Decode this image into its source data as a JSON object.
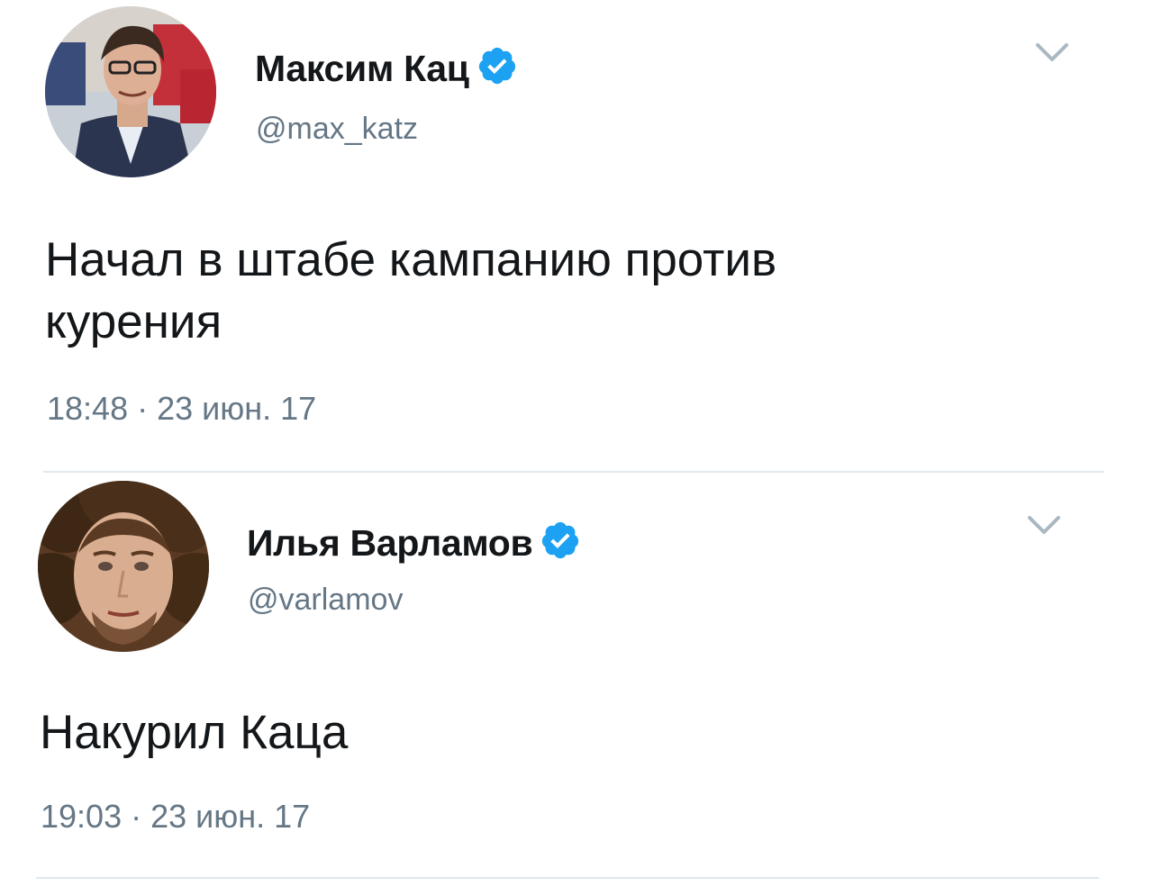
{
  "tweets": [
    {
      "display_name": "Максим Кац",
      "handle": "@max_katz",
      "verified": true,
      "text_lines": [
        "Начал в штабе кампанию против",
        "курения"
      ],
      "timestamp": "18:48 · 23 июн. 17",
      "avatar_icon": "user-avatar-max-katz"
    },
    {
      "display_name": "Илья Варламов",
      "handle": "@varlamov",
      "verified": true,
      "text_lines": [
        "Накурил Каца"
      ],
      "timestamp": "19:03 · 23 июн. 17",
      "avatar_icon": "user-avatar-varlamov"
    }
  ],
  "colors": {
    "verified_badge": "#1da1f2",
    "secondary_text": "#657786",
    "primary_text": "#14171a",
    "divider": "#e1e8ed",
    "caret": "#aab8c2"
  }
}
